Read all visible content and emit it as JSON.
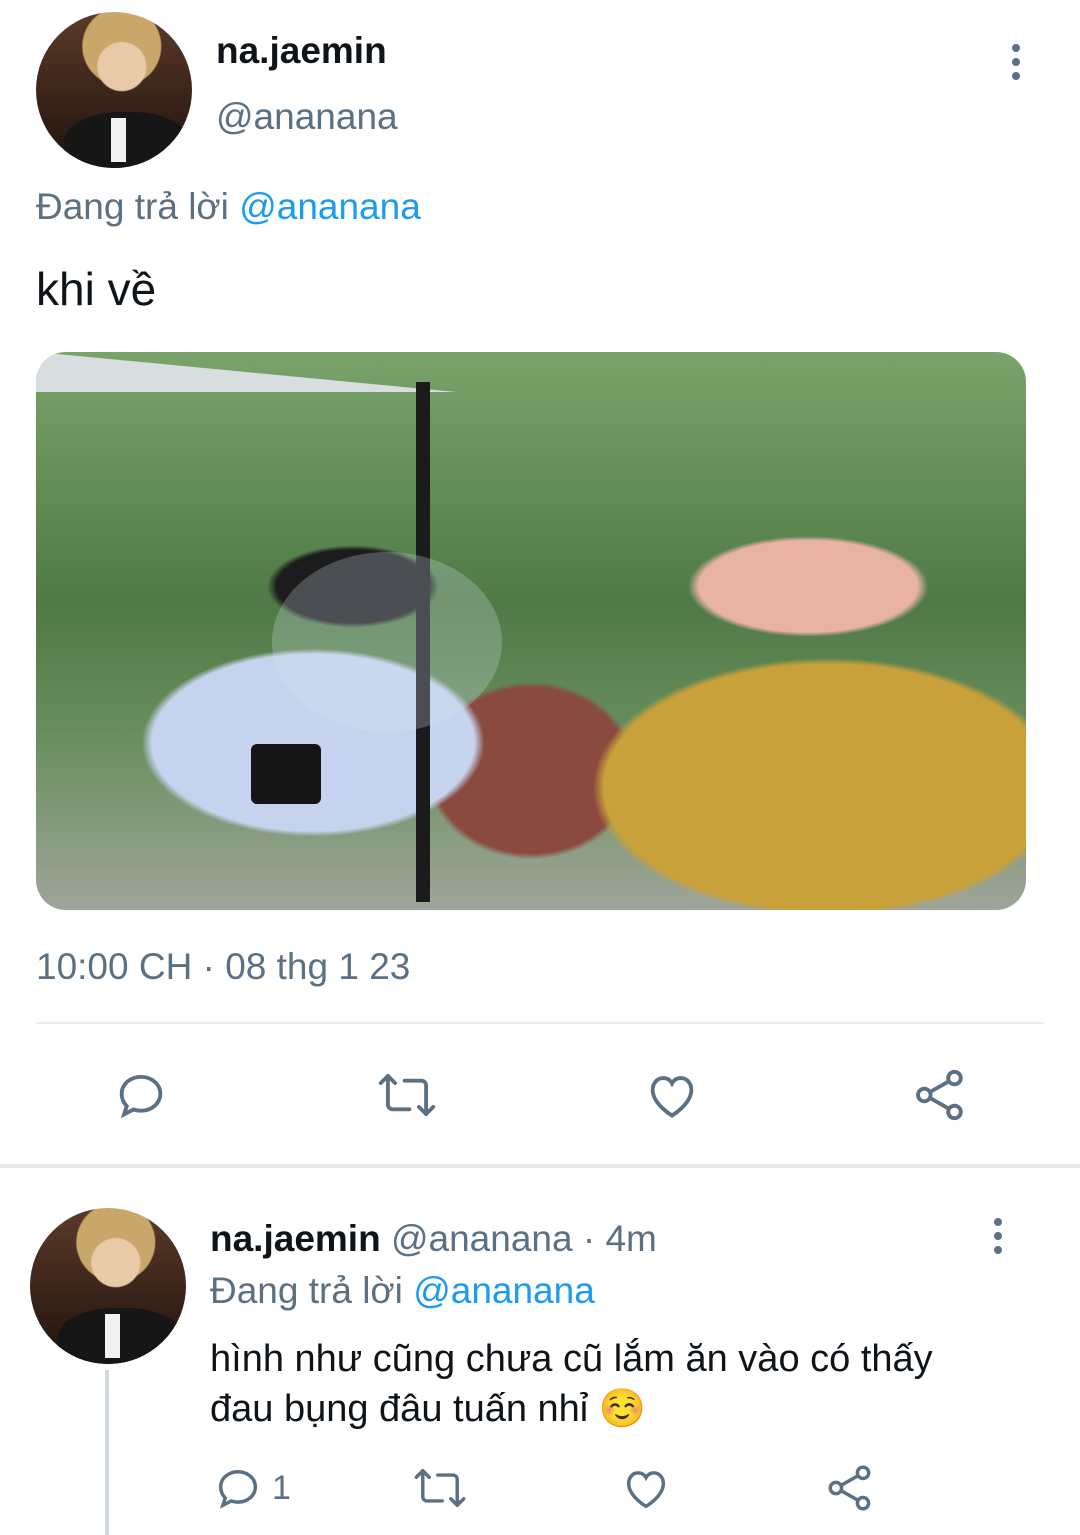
{
  "main_tweet": {
    "display_name": "na.jaemin",
    "handle": "@ananana",
    "reply_prefix": "Đang trả lời",
    "reply_to": "@ananana",
    "text": "khi về",
    "timestamp": "10:00 CH · 08 thg 1 23",
    "more_icon": "kebab-vertical-icon",
    "actions": [
      "reply-icon",
      "retweet-icon",
      "like-icon",
      "share-icon"
    ]
  },
  "reply_tweet": {
    "display_name": "na.jaemin",
    "handle": "@ananana",
    "time": "· 4m",
    "reply_prefix": "Đang trả lời",
    "reply_to": "@ananana",
    "text_line1": "hình như cũng chưa cũ lắm ăn vào có thấy",
    "text_line2": "đau bụng đâu tuấn nhỉ",
    "emoji": "☺️",
    "reply_count": "1",
    "actions": [
      "reply-icon",
      "retweet-icon",
      "like-icon",
      "share-icon"
    ]
  },
  "colors": {
    "muted": "#5b7083",
    "link": "#1d9bf0",
    "divider": "#e6ecf0"
  }
}
